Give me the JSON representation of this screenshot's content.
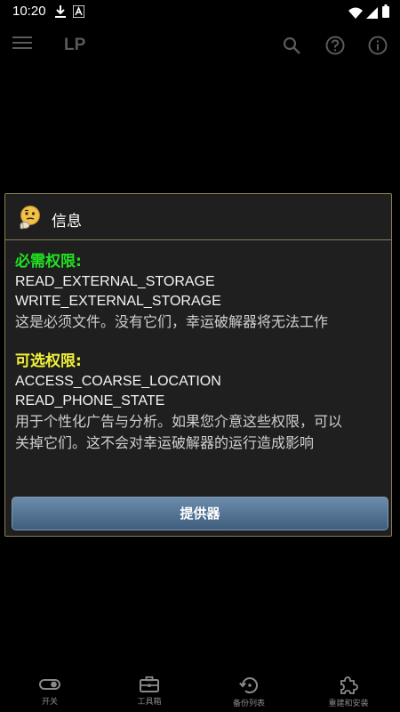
{
  "status_bar": {
    "time": "10:20"
  },
  "app_bar": {
    "title": "LP"
  },
  "dialog": {
    "title": "信息",
    "required_heading": "必需权限:",
    "required_permissions": [
      "READ_EXTERNAL_STORAGE",
      "WRITE_EXTERNAL_STORAGE"
    ],
    "required_description": "这是必须文件。没有它们，幸运破解器将无法工作",
    "optional_heading": "可选权限:",
    "optional_permissions": [
      "ACCESS_COARSE_LOCATION",
      "READ_PHONE_STATE"
    ],
    "optional_description_line1": "用于个性化广告与分析。如果您介意这些权限，可以",
    "optional_description_line2": "关掉它们。这不会对幸运破解器的运行造成影响",
    "button_label": "提供器"
  },
  "bottom_nav": {
    "items": [
      {
        "label": "开关",
        "icon": "toggle-icon"
      },
      {
        "label": "工具箱",
        "icon": "toolbox-icon"
      },
      {
        "label": "备份列表",
        "icon": "restore-icon"
      },
      {
        "label": "重建和安装",
        "icon": "puzzle-icon"
      }
    ]
  },
  "colors": {
    "background": "#000000",
    "dialog_background": "#1f1f1f",
    "dialog_border": "#8a7d55",
    "required_heading": "#22e122",
    "optional_heading": "#f1f13a",
    "button": "#4f6f90"
  }
}
